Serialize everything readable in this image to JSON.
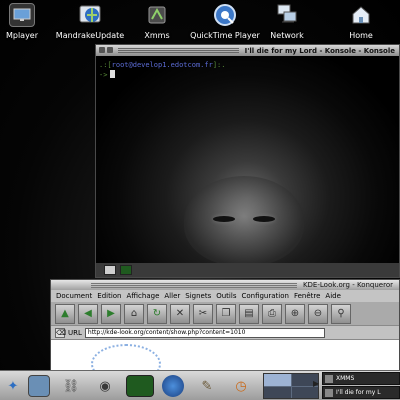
{
  "desktop_icons": [
    {
      "label": "Mplayer",
      "icon": "monitor-icon",
      "color": "#3a3a3a"
    },
    {
      "label": "MandrakeUpdate",
      "icon": "globe-update-icon",
      "color": "#2d6ec2"
    },
    {
      "label": "Xmms",
      "icon": "xmms-icon",
      "color": "#5a9c4a"
    },
    {
      "label": "QuickTime Player",
      "icon": "quicktime-icon",
      "color": "#3c78c8"
    },
    {
      "label": "Network",
      "icon": "network-icon",
      "color": "#6a8fb5"
    },
    {
      "label": "Home",
      "icon": "home-icon",
      "color": "#c9d8ea"
    }
  ],
  "konsole": {
    "title": "I'll die for my Lord - Konsole - Konsole",
    "prompt_line1_pre": ".:[",
    "prompt_host": "root@develop1.edotcom.fr",
    "prompt_line1_post": "]:.",
    "prompt_line2": "->"
  },
  "konqueror": {
    "title": "KDE-Look.org - Konqueror",
    "menu": [
      "Document",
      "Edition",
      "Affichage",
      "Aller",
      "Signets",
      "Outils",
      "Configuration",
      "Fenêtre",
      "Aide"
    ],
    "url_label": "URL",
    "url": "http://kde-look.org/content/show.php?content=1010"
  },
  "taskbar": {
    "tasks": [
      {
        "label": "XMMS"
      },
      {
        "label": "I'll die for my L"
      }
    ]
  },
  "colors": {
    "prompt_green": "#5a8f3a",
    "prompt_host_blue": "#5c6cd6",
    "taskbar": "#c0c0c0"
  }
}
